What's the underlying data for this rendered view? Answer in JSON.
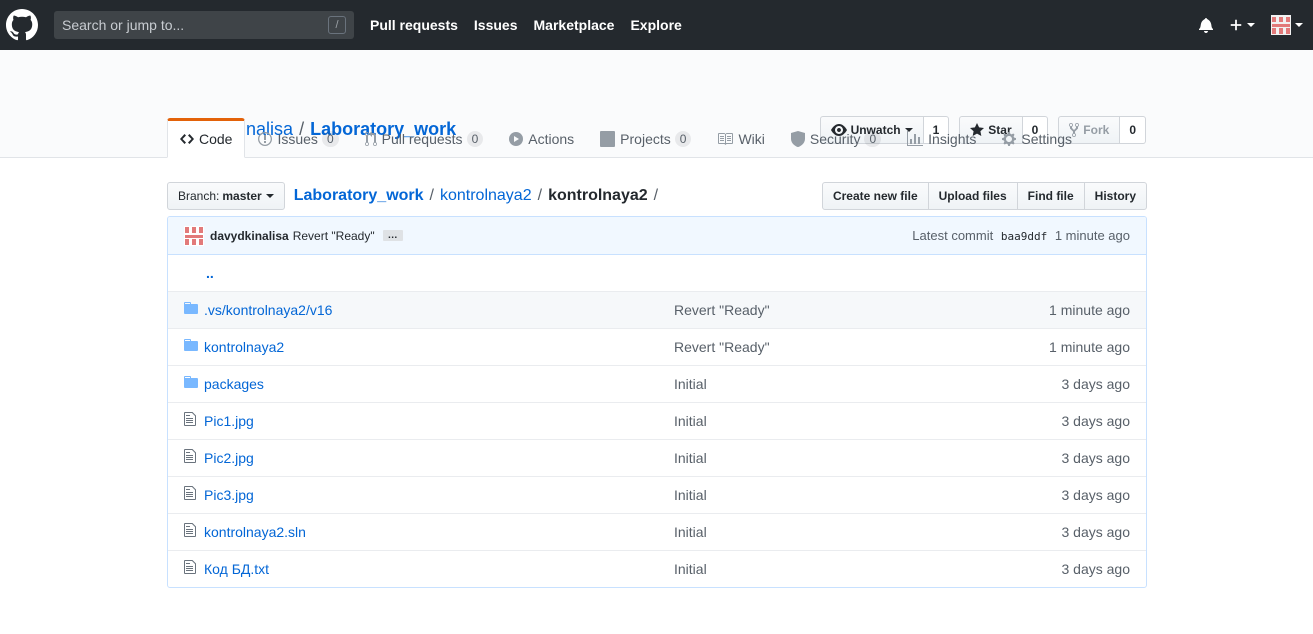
{
  "header": {
    "search_placeholder": "Search or jump to...",
    "search_key": "/",
    "nav": [
      "Pull requests",
      "Issues",
      "Marketplace",
      "Explore"
    ]
  },
  "repo": {
    "owner": "davydkinalisa",
    "separator": "/",
    "name": "Laboratory_work",
    "unwatch_label": "Unwatch",
    "watch_count": "1",
    "star_label": "Star",
    "star_count": "0",
    "fork_label": "Fork",
    "fork_count": "0"
  },
  "tabs": [
    {
      "label": "Code",
      "count": null
    },
    {
      "label": "Issues",
      "count": "0"
    },
    {
      "label": "Pull requests",
      "count": "0"
    },
    {
      "label": "Actions",
      "count": null
    },
    {
      "label": "Projects",
      "count": "0"
    },
    {
      "label": "Wiki",
      "count": null
    },
    {
      "label": "Security",
      "count": "0"
    },
    {
      "label": "Insights",
      "count": null
    },
    {
      "label": "Settings",
      "count": null
    }
  ],
  "file_nav": {
    "branch_prefix": "Branch:",
    "branch": "master",
    "crumb_root": "Laboratory_work",
    "crumb_mid": "kontrolnaya2",
    "crumb_current": "kontrolnaya2",
    "sep": "/",
    "actions": [
      "Create new file",
      "Upload files",
      "Find file",
      "History"
    ]
  },
  "commit": {
    "author": "davydkinalisa",
    "message": "Revert \"Ready\"",
    "ellipsis": "…",
    "latest_label": "Latest commit",
    "sha": "baa9ddf",
    "age": "1 minute ago"
  },
  "up_link": "..",
  "files": [
    {
      "type": "dir",
      "name": ".vs/kontrolnaya2/v16",
      "message": "Revert \"Ready\"",
      "age": "1 minute ago"
    },
    {
      "type": "dir",
      "name": "kontrolnaya2",
      "message": "Revert \"Ready\"",
      "age": "1 minute ago"
    },
    {
      "type": "dir",
      "name": "packages",
      "message": "Initial",
      "age": "3 days ago"
    },
    {
      "type": "file",
      "name": "Pic1.jpg",
      "message": "Initial",
      "age": "3 days ago"
    },
    {
      "type": "file",
      "name": "Pic2.jpg",
      "message": "Initial",
      "age": "3 days ago"
    },
    {
      "type": "file",
      "name": "Pic3.jpg",
      "message": "Initial",
      "age": "3 days ago"
    },
    {
      "type": "file",
      "name": "kontrolnaya2.sln",
      "message": "Initial",
      "age": "3 days ago"
    },
    {
      "type": "file",
      "name": "Код БД.txt",
      "message": "Initial",
      "age": "3 days ago"
    }
  ],
  "colors": {
    "header_bg": "#24292e",
    "link": "#0366d6",
    "tab_accent": "#e36209",
    "folder_icon": "#79b8ff"
  }
}
